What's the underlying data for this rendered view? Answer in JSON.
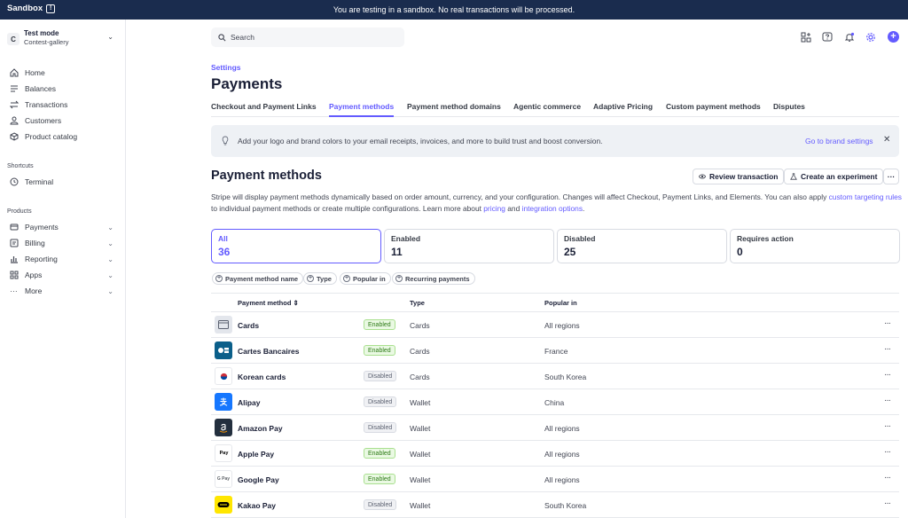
{
  "topbar": {
    "brand": "Sandbox",
    "brand_icon": "info-box-icon",
    "message": "You are testing in a sandbox. No real transactions will be processed."
  },
  "account": {
    "badge": "C",
    "mode": "Test mode",
    "name": "Contest-gallery"
  },
  "sidebar": {
    "main": [
      {
        "label": "Home",
        "icon": "home-icon"
      },
      {
        "label": "Balances",
        "icon": "balances-icon"
      },
      {
        "label": "Transactions",
        "icon": "transactions-icon"
      },
      {
        "label": "Customers",
        "icon": "customers-icon"
      },
      {
        "label": "Product catalog",
        "icon": "product-catalog-icon"
      }
    ],
    "shortcuts_label": "Shortcuts",
    "shortcuts": [
      {
        "label": "Terminal",
        "icon": "terminal-icon"
      }
    ],
    "products_label": "Products",
    "products": [
      {
        "label": "Payments",
        "icon": "payments-icon"
      },
      {
        "label": "Billing",
        "icon": "billing-icon"
      },
      {
        "label": "Reporting",
        "icon": "reporting-icon"
      },
      {
        "label": "Apps",
        "icon": "apps-icon"
      },
      {
        "label": "More",
        "icon": "more-dots-icon"
      }
    ]
  },
  "search": {
    "placeholder": "Search"
  },
  "header": {
    "breadcrumb": "Settings",
    "title": "Payments"
  },
  "tabs": [
    "Checkout and Payment Links",
    "Payment methods",
    "Payment method domains",
    "Agentic commerce",
    "Adaptive Pricing",
    "Custom payment methods",
    "Disputes"
  ],
  "active_tab": "Payment methods",
  "banner": {
    "text": "Add your logo and brand colors to your email receipts, invoices, and more to build trust and boost conversion.",
    "link": "Go to brand settings"
  },
  "section": {
    "title": "Payment methods",
    "review_button": "Review transaction",
    "experiment_button": "Create an experiment",
    "more_button": "···",
    "desc_1": "Stripe will display payment methods dynamically based on order amount, currency, and your configuration. Changes will affect Checkout, Payment Links, and Elements. You can also apply ",
    "desc_link_1": "custom targeting rules",
    "desc_2": " to individual payment methods or create multiple configurations. Learn more about ",
    "desc_link_2": "pricing",
    "desc_3": " and ",
    "desc_link_3": "integration options",
    "desc_4": "."
  },
  "summary_cards": [
    {
      "label": "All",
      "count": "36"
    },
    {
      "label": "Enabled",
      "count": "11"
    },
    {
      "label": "Disabled",
      "count": "25"
    },
    {
      "label": "Requires action",
      "count": "0"
    }
  ],
  "filters": [
    "Payment method name",
    "Type",
    "Popular in",
    "Recurring payments"
  ],
  "table": {
    "headers": {
      "method": "Payment method ⇕",
      "type": "Type",
      "popular": "Popular in"
    },
    "rows": [
      {
        "name": "Cards",
        "status": "Enabled",
        "type": "Cards",
        "popular": "All regions",
        "logo": "card-icon"
      },
      {
        "name": "Cartes Bancaires",
        "status": "Enabled",
        "type": "Cards",
        "popular": "France",
        "logo": "cartes-bancaires-icon"
      },
      {
        "name": "Korean cards",
        "status": "Disabled",
        "type": "Cards",
        "popular": "South Korea",
        "logo": "korea-flag-icon"
      },
      {
        "name": "Alipay",
        "status": "Disabled",
        "type": "Wallet",
        "popular": "China",
        "logo": "alipay-icon"
      },
      {
        "name": "Amazon Pay",
        "status": "Disabled",
        "type": "Wallet",
        "popular": "All regions",
        "logo": "amazon-icon"
      },
      {
        "name": "Apple Pay",
        "status": "Enabled",
        "type": "Wallet",
        "popular": "All regions",
        "logo": "apple-pay-icon",
        "logo_text": "Pay"
      },
      {
        "name": "Google Pay",
        "status": "Enabled",
        "type": "Wallet",
        "popular": "All regions",
        "logo": "google-pay-icon",
        "logo_text": "G Pay"
      },
      {
        "name": "Kakao Pay",
        "status": "Disabled",
        "type": "Wallet",
        "popular": "South Korea",
        "logo": "kakao-pay-icon"
      }
    ]
  },
  "colors": {
    "accent": "#635bff",
    "topbar": "#1a2c4e",
    "enabled": "#2c7a15"
  }
}
